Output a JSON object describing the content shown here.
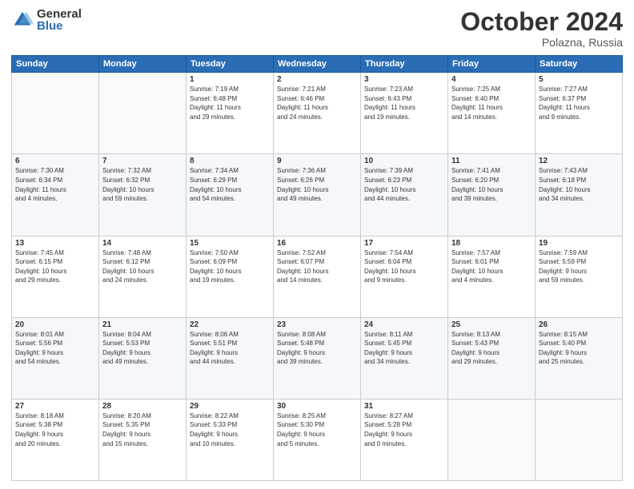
{
  "logo": {
    "general": "General",
    "blue": "Blue"
  },
  "header": {
    "month": "October 2024",
    "location": "Polazna, Russia"
  },
  "weekdays": [
    "Sunday",
    "Monday",
    "Tuesday",
    "Wednesday",
    "Thursday",
    "Friday",
    "Saturday"
  ],
  "weeks": [
    [
      {
        "day": "",
        "info": ""
      },
      {
        "day": "",
        "info": ""
      },
      {
        "day": "1",
        "info": "Sunrise: 7:19 AM\nSunset: 6:48 PM\nDaylight: 11 hours\nand 29 minutes."
      },
      {
        "day": "2",
        "info": "Sunrise: 7:21 AM\nSunset: 6:46 PM\nDaylight: 11 hours\nand 24 minutes."
      },
      {
        "day": "3",
        "info": "Sunrise: 7:23 AM\nSunset: 6:43 PM\nDaylight: 11 hours\nand 19 minutes."
      },
      {
        "day": "4",
        "info": "Sunrise: 7:25 AM\nSunset: 6:40 PM\nDaylight: 11 hours\nand 14 minutes."
      },
      {
        "day": "5",
        "info": "Sunrise: 7:27 AM\nSunset: 6:37 PM\nDaylight: 11 hours\nand 9 minutes."
      }
    ],
    [
      {
        "day": "6",
        "info": "Sunrise: 7:30 AM\nSunset: 6:34 PM\nDaylight: 11 hours\nand 4 minutes."
      },
      {
        "day": "7",
        "info": "Sunrise: 7:32 AM\nSunset: 6:32 PM\nDaylight: 10 hours\nand 59 minutes."
      },
      {
        "day": "8",
        "info": "Sunrise: 7:34 AM\nSunset: 6:29 PM\nDaylight: 10 hours\nand 54 minutes."
      },
      {
        "day": "9",
        "info": "Sunrise: 7:36 AM\nSunset: 6:26 PM\nDaylight: 10 hours\nand 49 minutes."
      },
      {
        "day": "10",
        "info": "Sunrise: 7:39 AM\nSunset: 6:23 PM\nDaylight: 10 hours\nand 44 minutes."
      },
      {
        "day": "11",
        "info": "Sunrise: 7:41 AM\nSunset: 6:20 PM\nDaylight: 10 hours\nand 39 minutes."
      },
      {
        "day": "12",
        "info": "Sunrise: 7:43 AM\nSunset: 6:18 PM\nDaylight: 10 hours\nand 34 minutes."
      }
    ],
    [
      {
        "day": "13",
        "info": "Sunrise: 7:45 AM\nSunset: 6:15 PM\nDaylight: 10 hours\nand 29 minutes."
      },
      {
        "day": "14",
        "info": "Sunrise: 7:48 AM\nSunset: 6:12 PM\nDaylight: 10 hours\nand 24 minutes."
      },
      {
        "day": "15",
        "info": "Sunrise: 7:50 AM\nSunset: 6:09 PM\nDaylight: 10 hours\nand 19 minutes."
      },
      {
        "day": "16",
        "info": "Sunrise: 7:52 AM\nSunset: 6:07 PM\nDaylight: 10 hours\nand 14 minutes."
      },
      {
        "day": "17",
        "info": "Sunrise: 7:54 AM\nSunset: 6:04 PM\nDaylight: 10 hours\nand 9 minutes."
      },
      {
        "day": "18",
        "info": "Sunrise: 7:57 AM\nSunset: 6:01 PM\nDaylight: 10 hours\nand 4 minutes."
      },
      {
        "day": "19",
        "info": "Sunrise: 7:59 AM\nSunset: 5:59 PM\nDaylight: 9 hours\nand 59 minutes."
      }
    ],
    [
      {
        "day": "20",
        "info": "Sunrise: 8:01 AM\nSunset: 5:56 PM\nDaylight: 9 hours\nand 54 minutes."
      },
      {
        "day": "21",
        "info": "Sunrise: 8:04 AM\nSunset: 5:53 PM\nDaylight: 9 hours\nand 49 minutes."
      },
      {
        "day": "22",
        "info": "Sunrise: 8:06 AM\nSunset: 5:51 PM\nDaylight: 9 hours\nand 44 minutes."
      },
      {
        "day": "23",
        "info": "Sunrise: 8:08 AM\nSunset: 5:48 PM\nDaylight: 9 hours\nand 39 minutes."
      },
      {
        "day": "24",
        "info": "Sunrise: 8:11 AM\nSunset: 5:45 PM\nDaylight: 9 hours\nand 34 minutes."
      },
      {
        "day": "25",
        "info": "Sunrise: 8:13 AM\nSunset: 5:43 PM\nDaylight: 9 hours\nand 29 minutes."
      },
      {
        "day": "26",
        "info": "Sunrise: 8:15 AM\nSunset: 5:40 PM\nDaylight: 9 hours\nand 25 minutes."
      }
    ],
    [
      {
        "day": "27",
        "info": "Sunrise: 8:18 AM\nSunset: 5:38 PM\nDaylight: 9 hours\nand 20 minutes."
      },
      {
        "day": "28",
        "info": "Sunrise: 8:20 AM\nSunset: 5:35 PM\nDaylight: 9 hours\nand 15 minutes."
      },
      {
        "day": "29",
        "info": "Sunrise: 8:22 AM\nSunset: 5:33 PM\nDaylight: 9 hours\nand 10 minutes."
      },
      {
        "day": "30",
        "info": "Sunrise: 8:25 AM\nSunset: 5:30 PM\nDaylight: 9 hours\nand 5 minutes."
      },
      {
        "day": "31",
        "info": "Sunrise: 8:27 AM\nSunset: 5:28 PM\nDaylight: 9 hours\nand 0 minutes."
      },
      {
        "day": "",
        "info": ""
      },
      {
        "day": "",
        "info": ""
      }
    ]
  ]
}
